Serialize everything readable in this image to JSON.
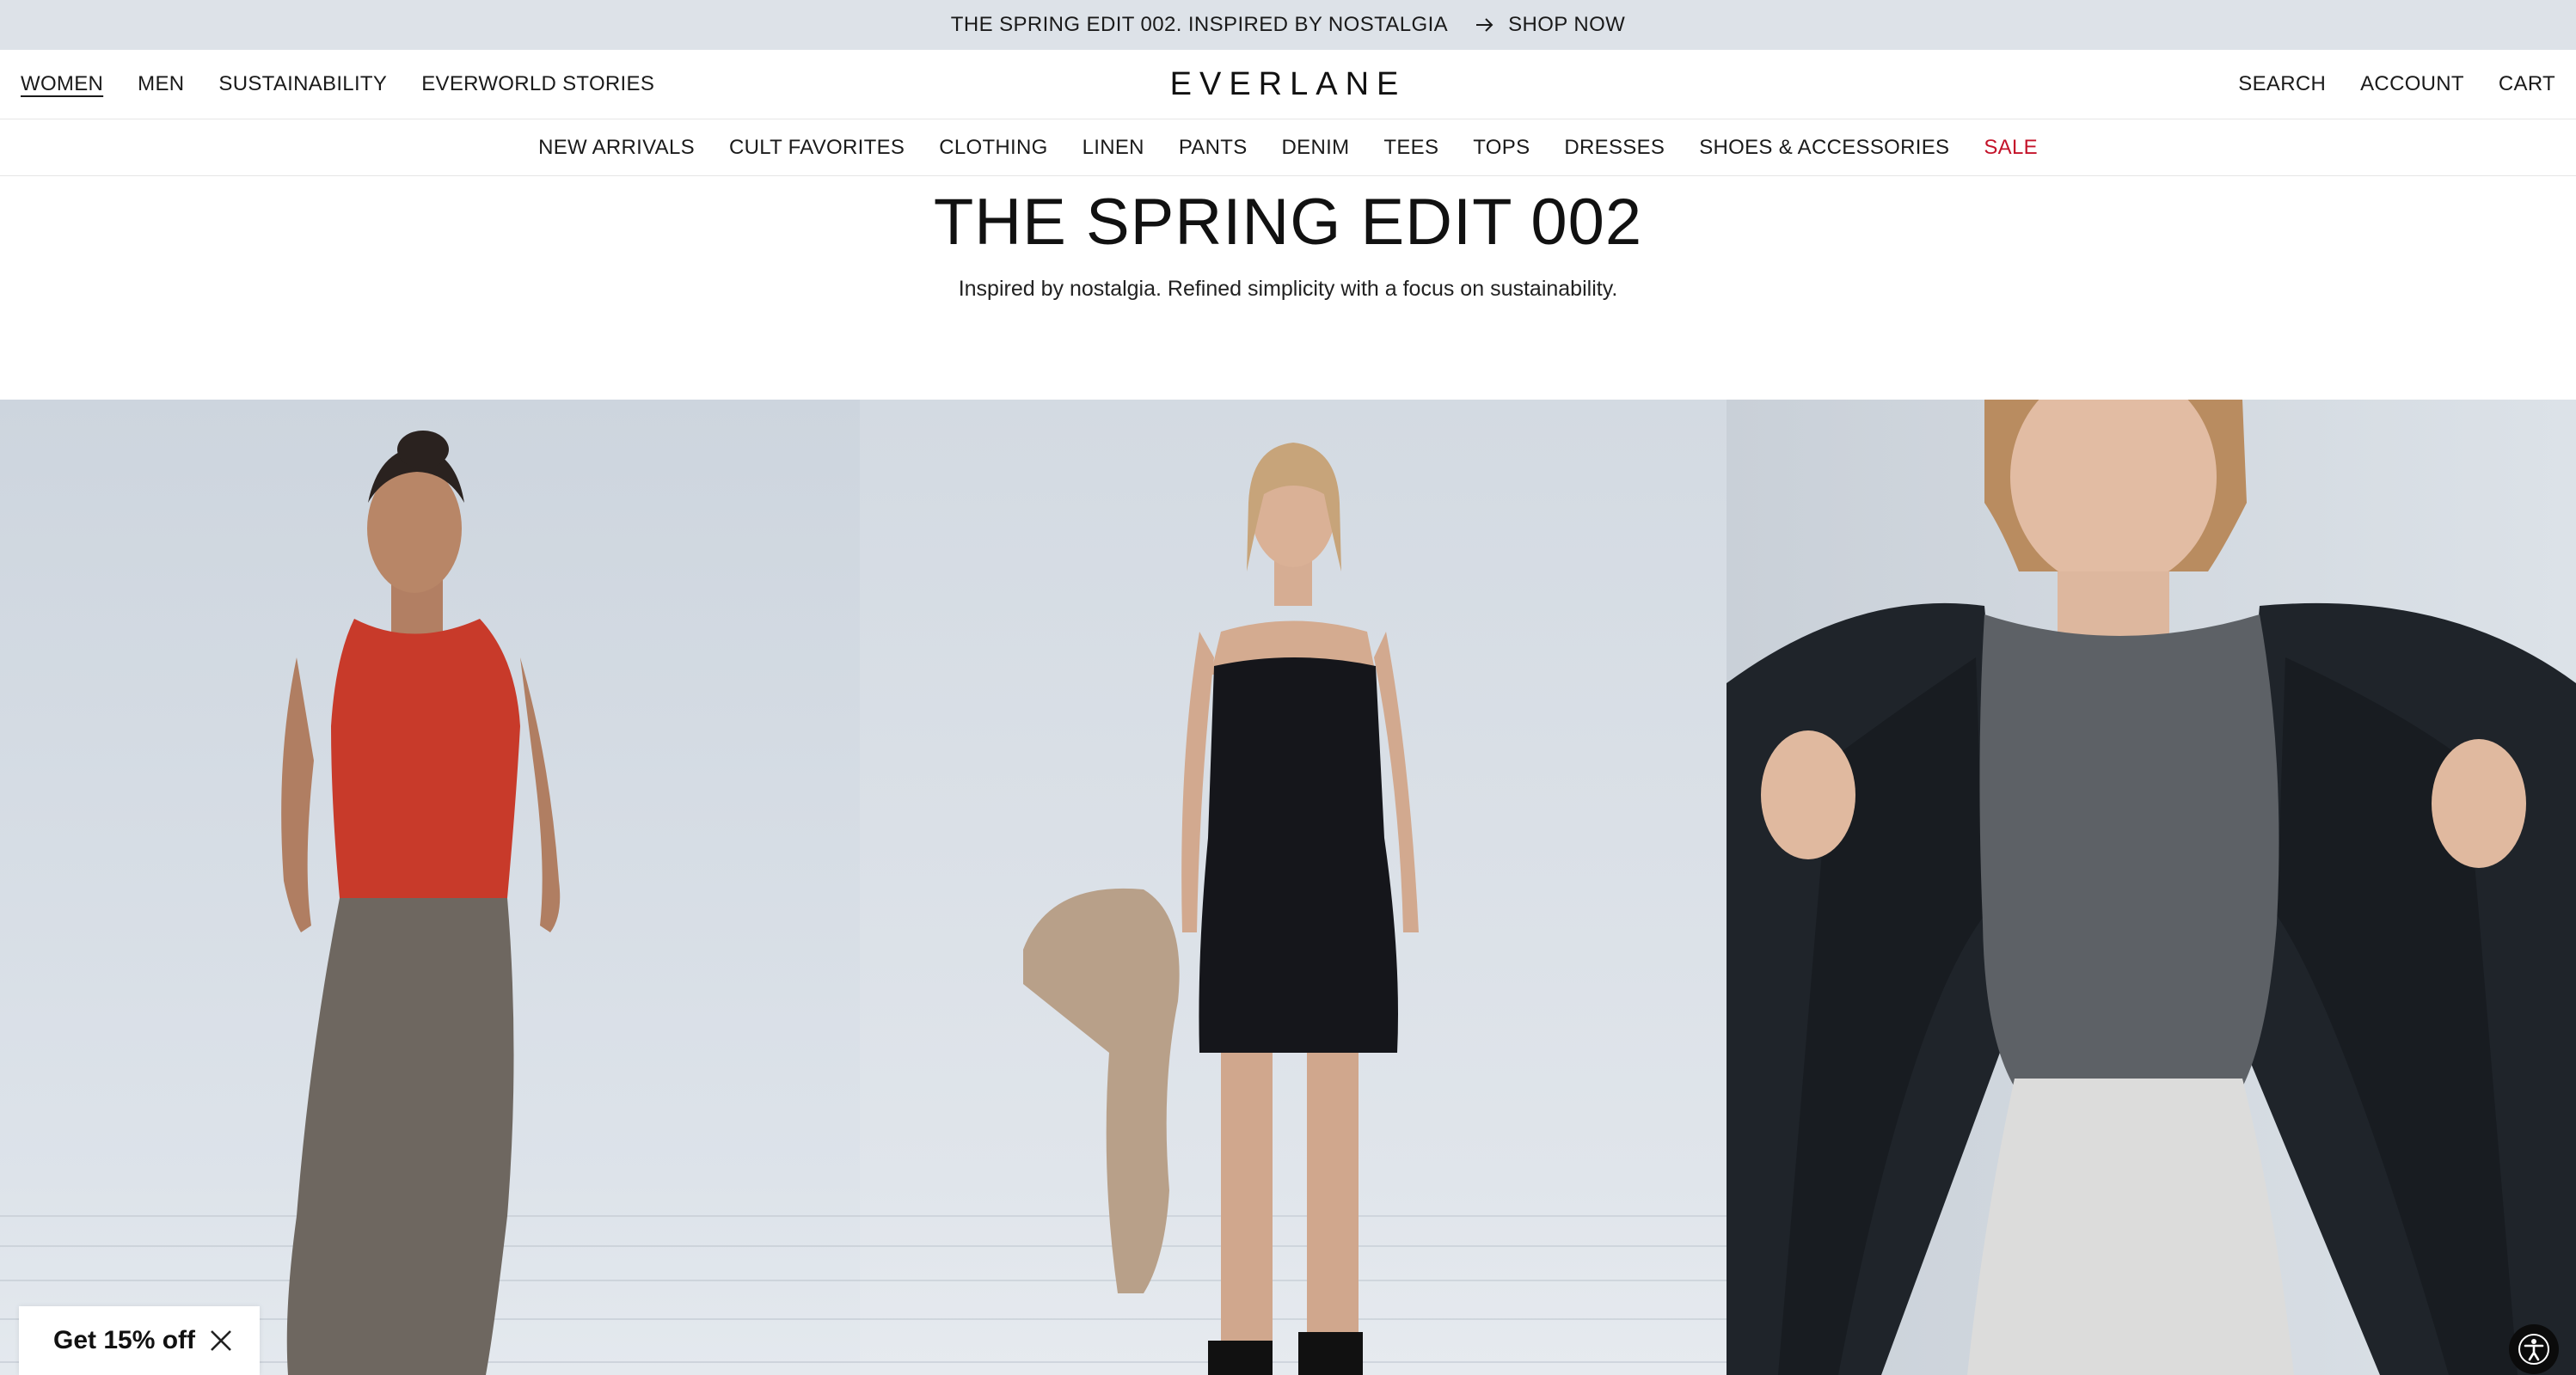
{
  "announcement": {
    "text": "THE SPRING EDIT 002. INSPIRED BY NOSTALGIA",
    "cta": "SHOP NOW",
    "icon": "arrow-right-icon"
  },
  "header": {
    "left_links": [
      "WOMEN",
      "MEN",
      "SUSTAINABILITY",
      "EVERWORLD STORIES"
    ],
    "active": "WOMEN",
    "logo": "EVERLANE",
    "right_links": [
      "SEARCH",
      "ACCOUNT",
      "CART"
    ]
  },
  "categories": [
    "NEW ARRIVALS",
    "CULT FAVORITES",
    "CLOTHING",
    "LINEN",
    "PANTS",
    "DENIM",
    "TEES",
    "TOPS",
    "DRESSES",
    "SHOES & ACCESSORIES",
    "SALE"
  ],
  "hero": {
    "title_main": "THE SPRING EDIT ",
    "title_num": "002",
    "subtitle": "Inspired by nostalgia. Refined simplicity with a focus on sustainability."
  },
  "promo": {
    "label": "Get 15% off",
    "close_icon": "close-icon"
  },
  "colors": {
    "announcement_bg": "#dde2e8",
    "sale": "#c4132a",
    "photo_bg": "#d8dee5"
  },
  "accessibility": {
    "icon": "accessibility-icon"
  }
}
